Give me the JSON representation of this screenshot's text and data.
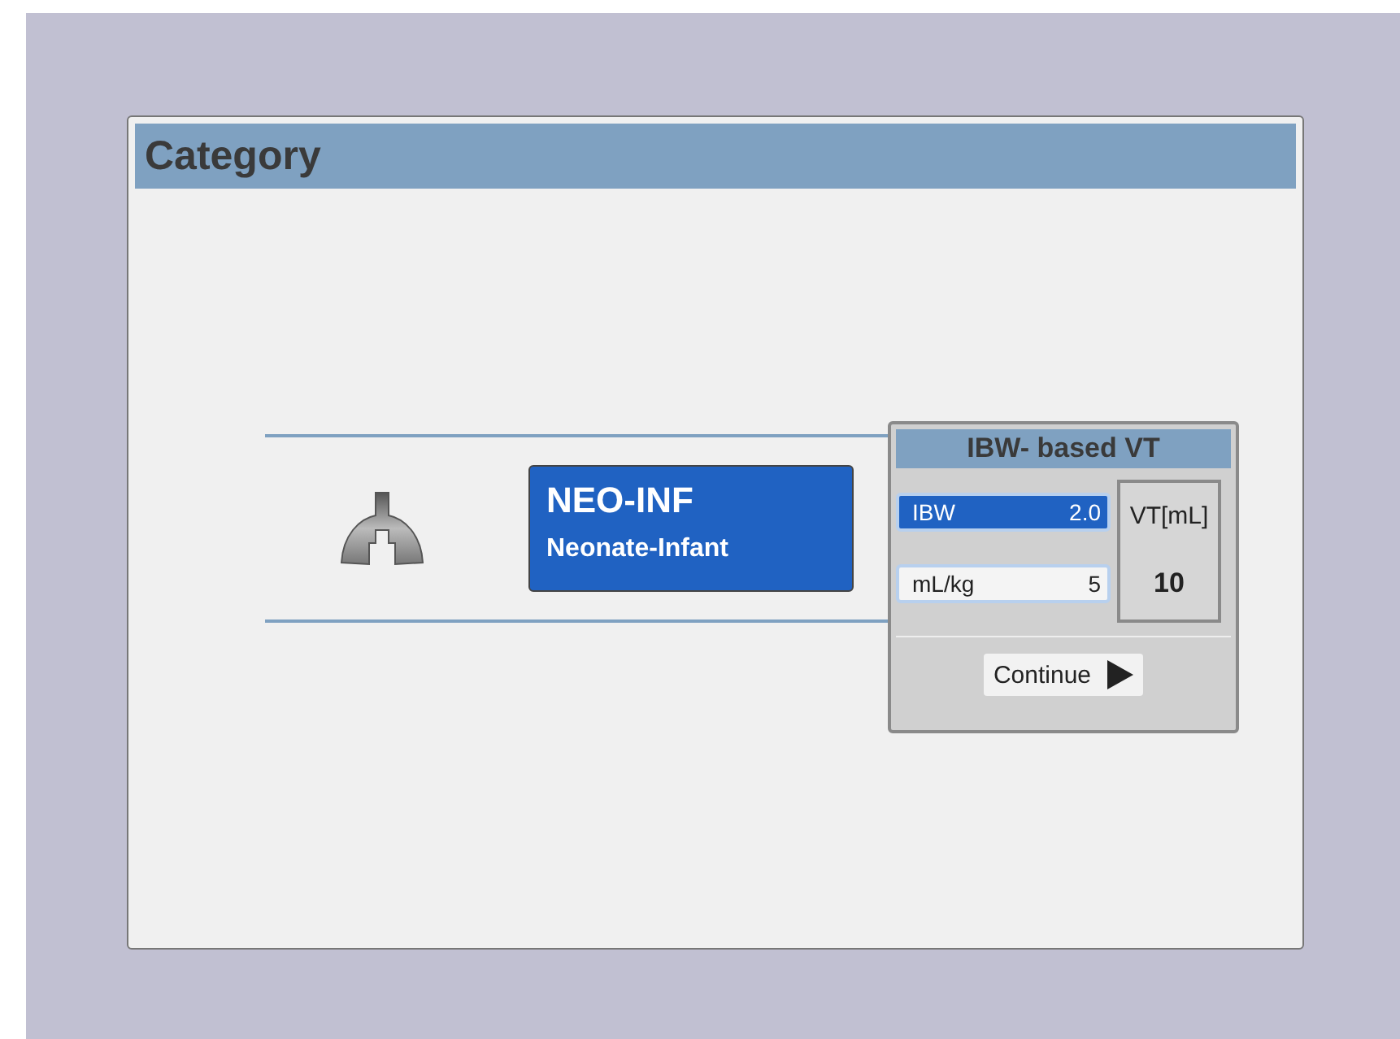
{
  "window": {
    "title": "Category"
  },
  "categories": [
    {
      "code": "NEO-INF",
      "name": "Neonate-Infant",
      "selected": true
    }
  ],
  "ibw_popup": {
    "title": "IBW- based VT",
    "fields": [
      {
        "label": "IBW",
        "value": "2.0",
        "selected": true
      },
      {
        "label": "mL/kg",
        "value": "5",
        "selected": false
      }
    ],
    "result": {
      "label": "VT[mL]",
      "value": "10"
    },
    "continue_button": "Continue"
  }
}
